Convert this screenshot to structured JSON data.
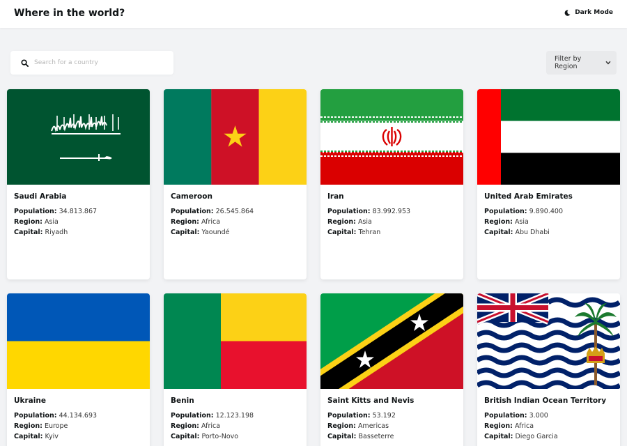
{
  "header": {
    "title": "Where in the world?",
    "dark_mode_label": "Dark Mode"
  },
  "search": {
    "placeholder": "Search for a country",
    "value": ""
  },
  "filter": {
    "label": "Filter by Region"
  },
  "field_labels": {
    "population": "Population:",
    "region": "Region:",
    "capital": "Capital:"
  },
  "countries": [
    {
      "name": "Saudi Arabia",
      "population": "34.813.867",
      "region": "Asia",
      "capital": "Riyadh",
      "flag": "saudi-arabia-flag"
    },
    {
      "name": "Cameroon",
      "population": "26.545.864",
      "region": "Africa",
      "capital": "Yaoundé",
      "flag": "cameroon-flag"
    },
    {
      "name": "Iran",
      "population": "83.992.953",
      "region": "Asia",
      "capital": "Tehran",
      "flag": "iran-flag"
    },
    {
      "name": "United Arab Emirates",
      "population": "9.890.400",
      "region": "Asia",
      "capital": "Abu Dhabi",
      "flag": "uae-flag"
    },
    {
      "name": "Ukraine",
      "population": "44.134.693",
      "region": "Europe",
      "capital": "Kyiv",
      "flag": "ukraine-flag"
    },
    {
      "name": "Benin",
      "population": "12.123.198",
      "region": "Africa",
      "capital": "Porto-Novo",
      "flag": "benin-flag"
    },
    {
      "name": "Saint Kitts and Nevis",
      "population": "53.192",
      "region": "Americas",
      "capital": "Basseterre",
      "flag": "saint-kitts-and-nevis-flag"
    },
    {
      "name": "British Indian Ocean Territory",
      "population": "3.000",
      "region": "Africa",
      "capital": "Diego Garcia",
      "flag": "british-indian-ocean-territory-flag"
    }
  ],
  "colors": {
    "background": "#f2f3f5",
    "card": "#ffffff",
    "text": "#111517"
  }
}
